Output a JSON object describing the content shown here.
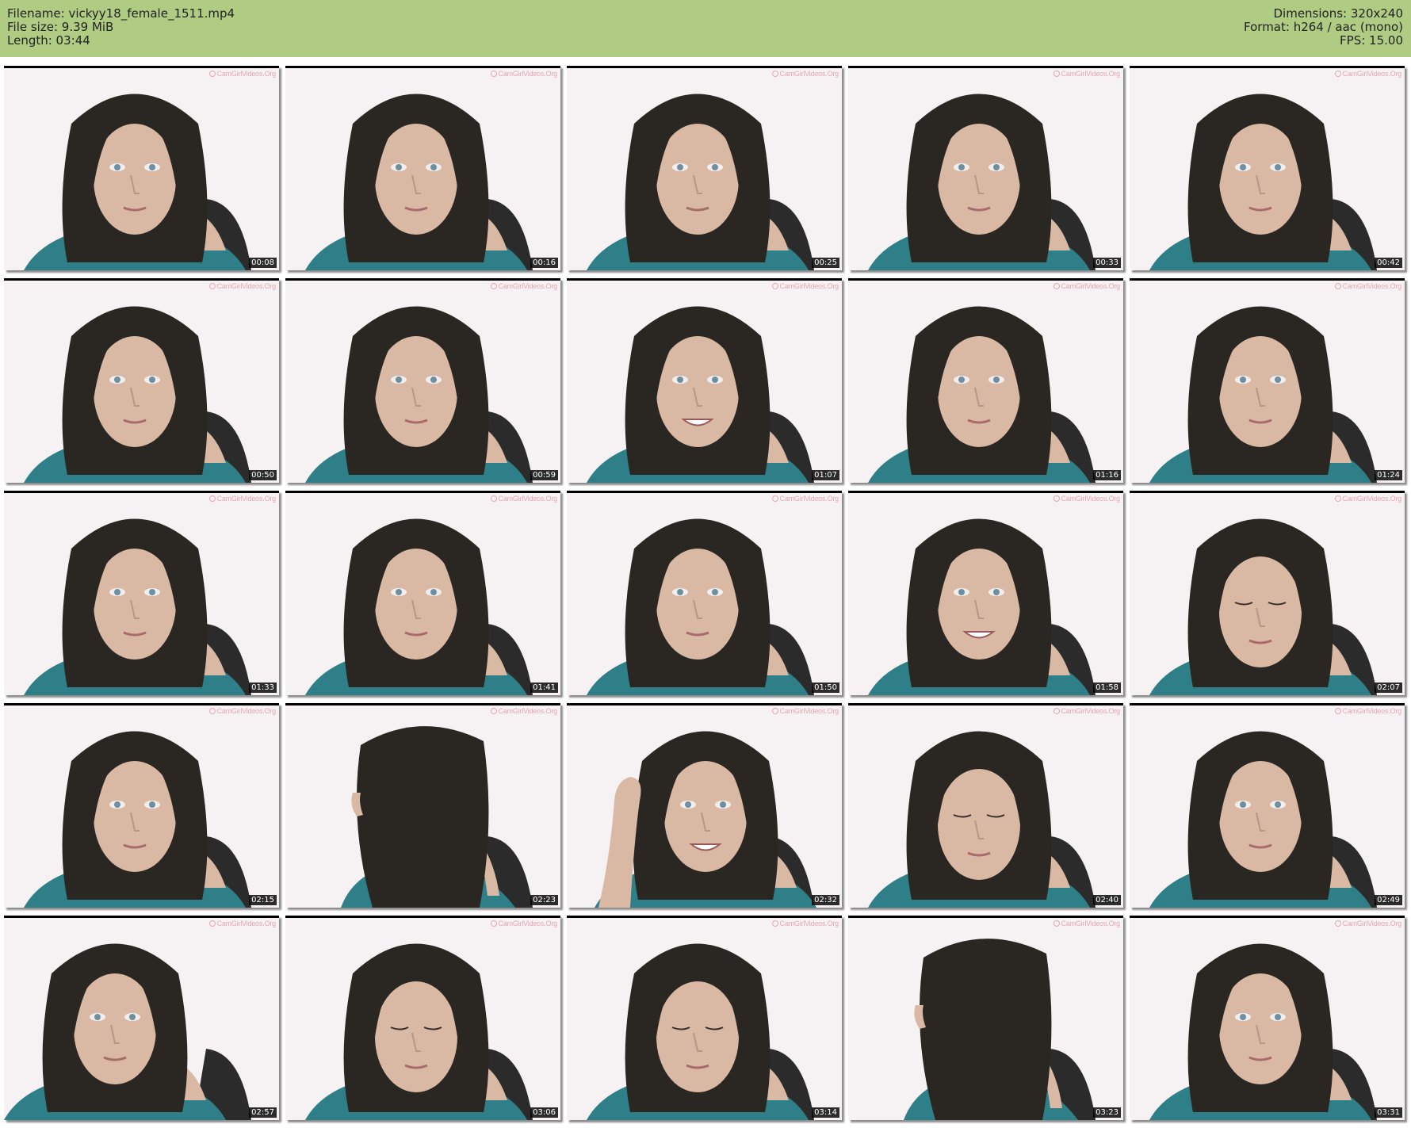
{
  "header": {
    "filename_line": "Filename: vickyy18_female_1511.mp4",
    "filesize_line": "File size: 9.39 MiB",
    "length_line": "Length: 03:44",
    "dimensions_line": "Dimensions: 320x240",
    "format_line": "Format: h264 / aac (mono)",
    "fps_line": "FPS: 15.00",
    "background_color": "#b0cc83"
  },
  "watermark": "CamGirlVideos.Org",
  "thumbnails": [
    {
      "time": "00:08",
      "pose": "center"
    },
    {
      "time": "00:16",
      "pose": "center"
    },
    {
      "time": "00:25",
      "pose": "center"
    },
    {
      "time": "00:33",
      "pose": "center"
    },
    {
      "time": "00:42",
      "pose": "center"
    },
    {
      "time": "00:50",
      "pose": "center"
    },
    {
      "time": "00:59",
      "pose": "center"
    },
    {
      "time": "01:07",
      "pose": "smile"
    },
    {
      "time": "01:16",
      "pose": "center"
    },
    {
      "time": "01:24",
      "pose": "center"
    },
    {
      "time": "01:33",
      "pose": "center"
    },
    {
      "time": "01:41",
      "pose": "center"
    },
    {
      "time": "01:50",
      "pose": "center"
    },
    {
      "time": "01:58",
      "pose": "smile"
    },
    {
      "time": "02:07",
      "pose": "down"
    },
    {
      "time": "02:15",
      "pose": "center"
    },
    {
      "time": "02:23",
      "pose": "back"
    },
    {
      "time": "02:32",
      "pose": "hand"
    },
    {
      "time": "02:40",
      "pose": "down"
    },
    {
      "time": "02:49",
      "pose": "center"
    },
    {
      "time": "02:57",
      "pose": "left"
    },
    {
      "time": "03:06",
      "pose": "down"
    },
    {
      "time": "03:14",
      "pose": "down"
    },
    {
      "time": "03:23",
      "pose": "back"
    },
    {
      "time": "03:31",
      "pose": "center"
    }
  ]
}
